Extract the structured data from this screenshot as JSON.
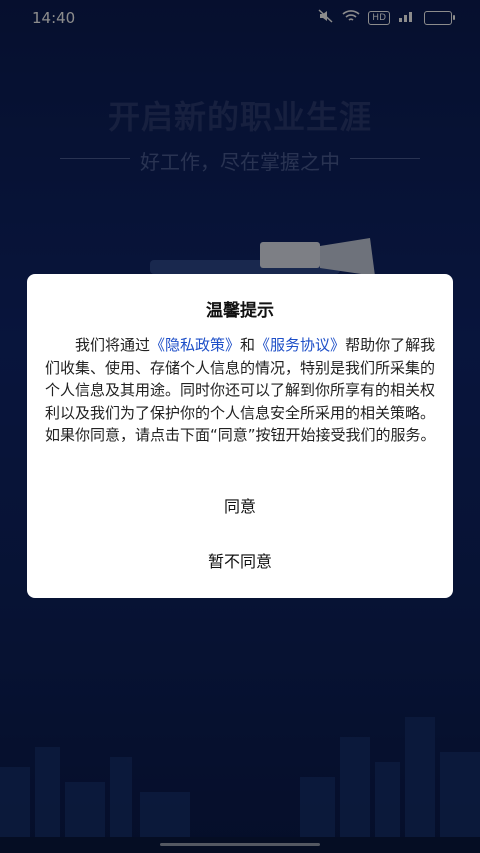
{
  "status_bar": {
    "time": "14:40",
    "hd_label": "HD",
    "signal_label": "4G"
  },
  "background": {
    "title": "开启新的职业生涯",
    "subtitle": "好工作，尽在掌握之中"
  },
  "dialog": {
    "title": "温馨提示",
    "body_prefix": "我们将通过",
    "privacy_link": "《隐私政策》",
    "conjunction": "和",
    "service_link": "《服务协议》",
    "body_suffix": "帮助你了解我们收集、使用、存储个人信息的情况，特别是我们所采集的个人信息及其用途。同时你还可以了解到你所享有的相关权利以及我们为了保护你的个人信息安全所采用的相关策略。如果你同意，请点击下面“同意”按钮开始接受我们的服务。",
    "agree_button": "同意",
    "disagree_button": "暂不同意"
  },
  "colors": {
    "link": "#1e4fc8",
    "background": "#0d1f57"
  }
}
